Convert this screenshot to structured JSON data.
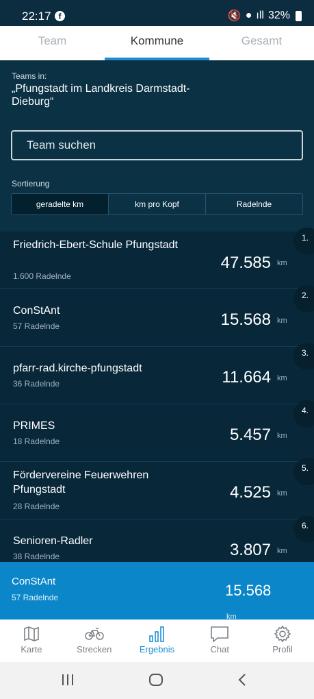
{
  "status": {
    "time": "22:17",
    "battery": "32%"
  },
  "tabs": [
    "Team",
    "Kommune",
    "Gesamt"
  ],
  "header": {
    "teams_in": "Teams in:",
    "region": "„Pfungstadt im Landkreis Darmstadt-Dieburg“"
  },
  "search": {
    "placeholder": "Team suchen"
  },
  "sort": {
    "label": "Sortierung",
    "options": [
      "geradelte km",
      "km pro Kopf",
      "Radelnde"
    ],
    "selected": "geradelte km"
  },
  "teams": [
    {
      "rank": "1.",
      "name": "Friedrich-Ebert-Schule Pfungstadt",
      "members": "1.600 Radelnde",
      "km": "47.585",
      "unit": "km"
    },
    {
      "rank": "2.",
      "name": "ConStAnt",
      "members": "57 Radelnde",
      "km": "15.568",
      "unit": "km"
    },
    {
      "rank": "3.",
      "name": "pfarr-rad.kirche-pfungstadt",
      "members": "36 Radelnde",
      "km": "11.664",
      "unit": "km"
    },
    {
      "rank": "4.",
      "name": "PRIMES",
      "members": "18 Radelnde",
      "km": "5.457",
      "unit": "km"
    },
    {
      "rank": "5.",
      "name": "Fördervereine Feuerwehren Pfungstadt",
      "members": "28 Radelnde",
      "km": "4.525",
      "unit": "km"
    },
    {
      "rank": "6.",
      "name": "Senioren-Radler",
      "members": "38 Radelnde",
      "km": "3.807",
      "unit": "km"
    }
  ],
  "my_team": {
    "name": "ConStAnt",
    "members": "57 Radelnde",
    "km": "15.568",
    "unit": "km"
  },
  "nav": [
    "Karte",
    "Strecken",
    "Ergebnis",
    "Chat",
    "Profil"
  ],
  "colors": {
    "accent": "#1e8fd5",
    "background": "#0b3144",
    "highlight": "#0a86c9"
  }
}
